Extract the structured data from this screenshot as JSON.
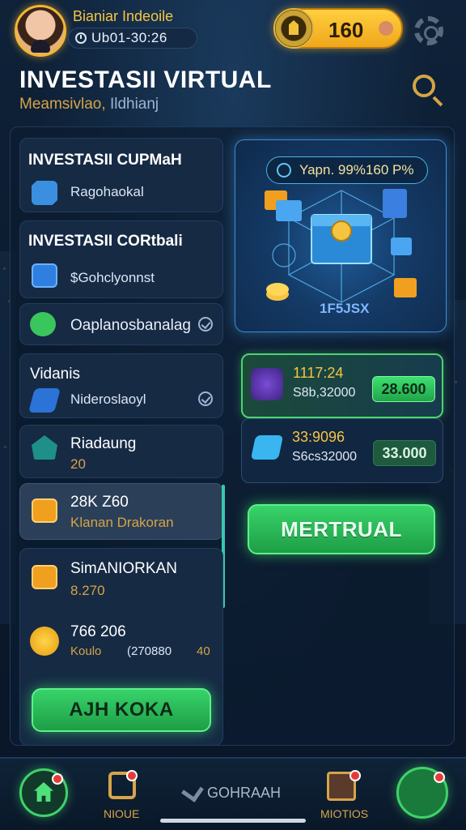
{
  "header": {
    "username": "Bianiar Indeoile",
    "timer": "Ub01-30:26",
    "coins": "160",
    "title": "INVESTASII VIRTUAL",
    "subtitle_a": "Meamsivlao,",
    "subtitle_b": "Ildhianj"
  },
  "left_list": [
    {
      "label": "INVESTASII CUPMaH",
      "sub": "Ragohaokal"
    },
    {
      "label": "INVESTASII CORtbali",
      "sub": "$Gohclyonnst"
    },
    {
      "label": "Oaplanosbanalag"
    },
    {
      "label": "Vidanis",
      "sub": "Nideroslaoyl"
    },
    {
      "label": "Riadaung",
      "sub": "20"
    },
    {
      "label": "28K Z60",
      "sub": "Klanan Drakoran"
    },
    {
      "label": "SimANIORKAN",
      "sub": "8.270"
    },
    {
      "label": "766 206",
      "sub_a": "Koulo",
      "sub_b": "(270880",
      "sub_c": "40"
    }
  ],
  "left_button": "AJH KOKA",
  "hero": {
    "yield": "Yapn. 99%160 P%",
    "value": "1F5JSX"
  },
  "offers": [
    {
      "title": "1117:24",
      "sub": "S8b,32000",
      "amount": "28.600"
    },
    {
      "title": "33:9096",
      "sub": "S6cs32000",
      "amount": "33.000"
    }
  ],
  "right_button": "MERTRUAL",
  "nav": {
    "item2": "NIOUE",
    "item3": "GOHRAAH",
    "item4": "MIOTIOS"
  },
  "colors": {
    "accent_gold": "#f5c542",
    "accent_green": "#38d36a",
    "panel_blue": "#162a44"
  }
}
